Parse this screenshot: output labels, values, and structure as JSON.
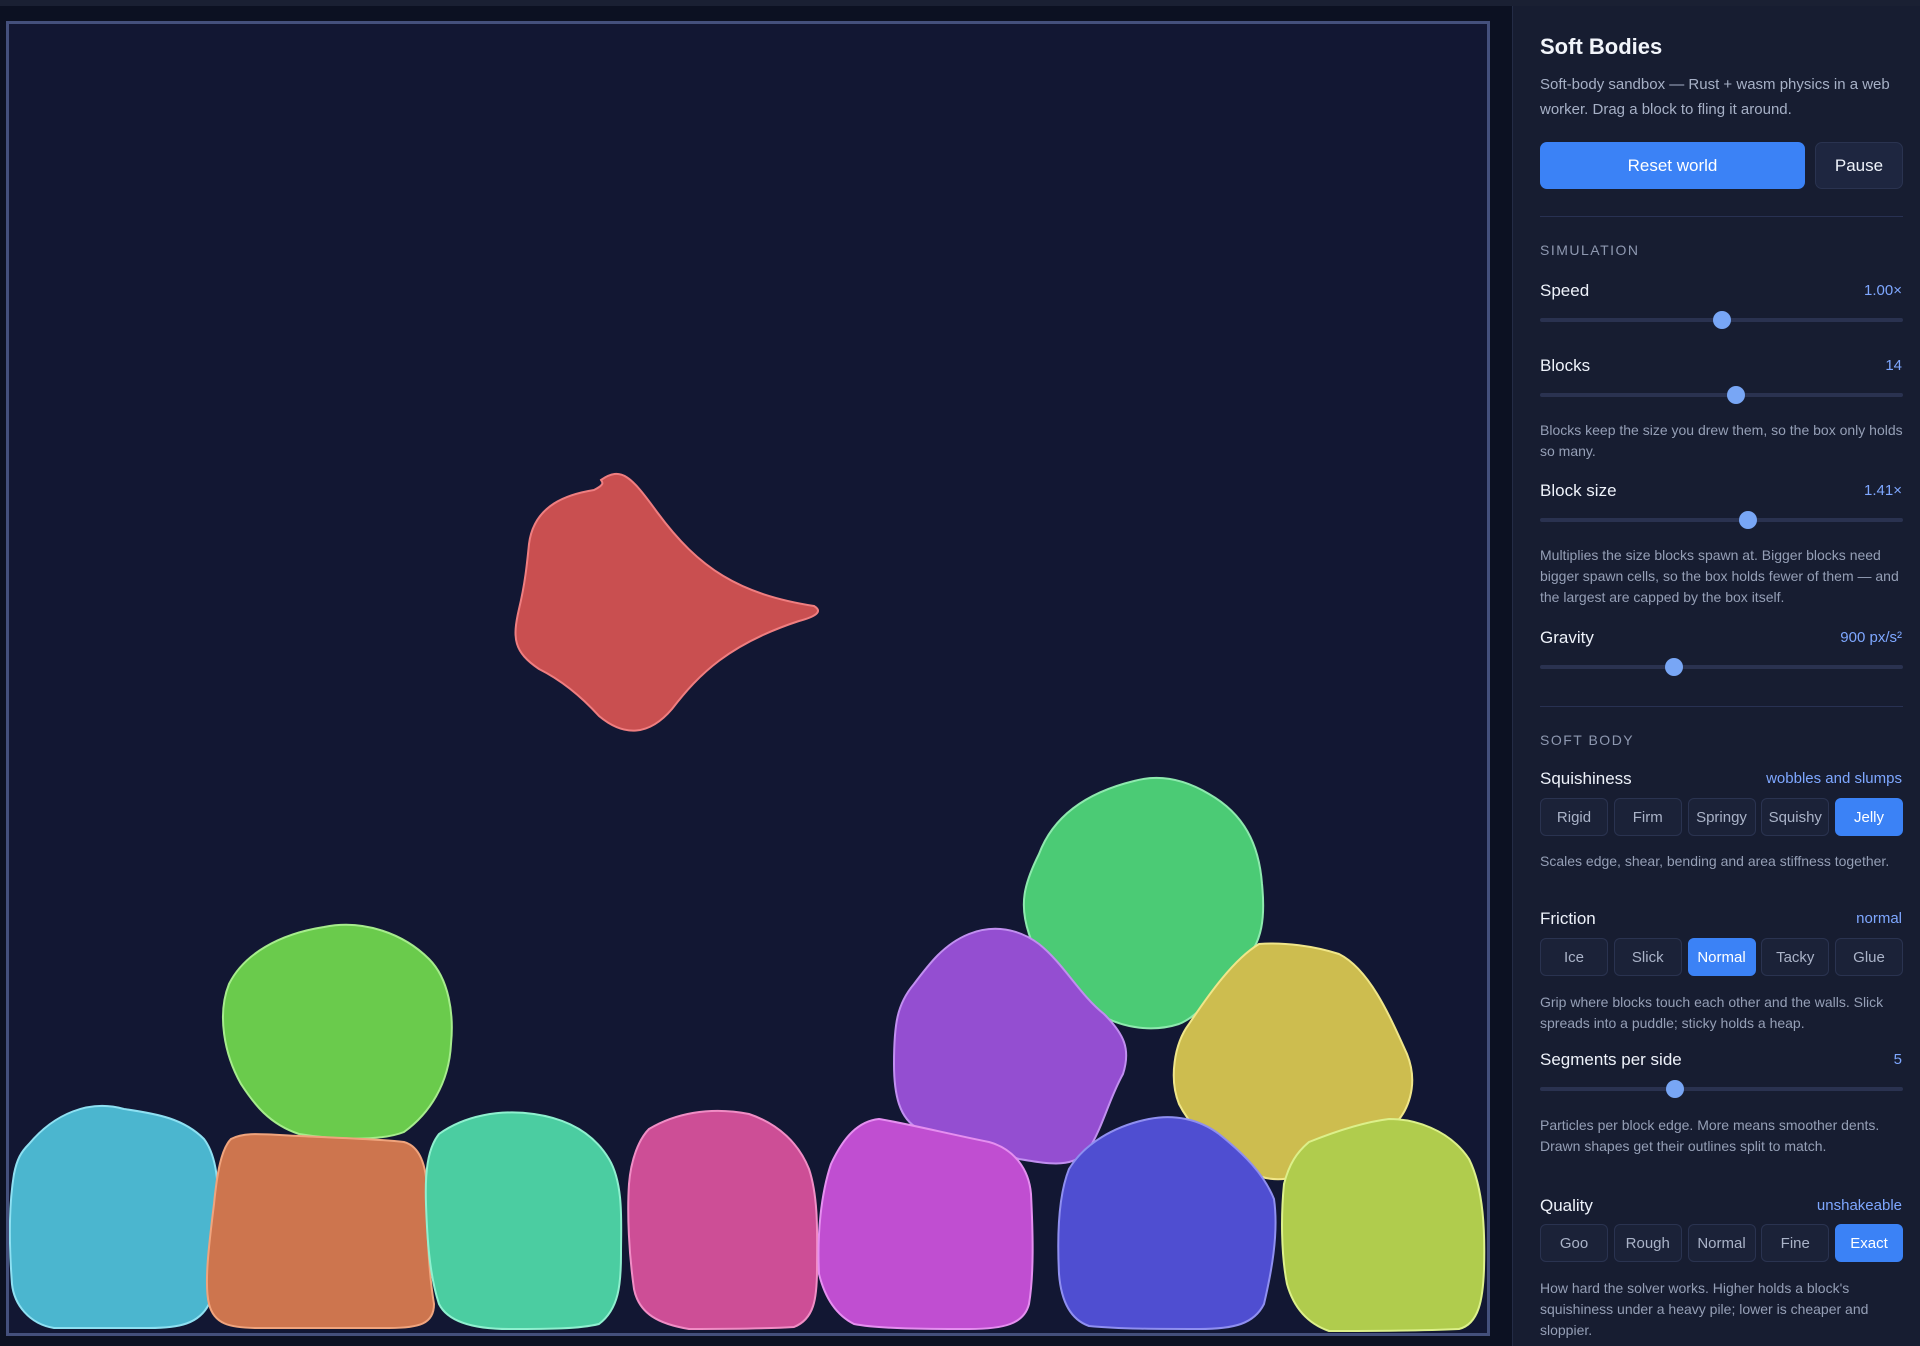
{
  "panel": {
    "title": "Soft Bodies",
    "description": "Soft-body sandbox — Rust + wasm physics in a web worker. Drag a block to fling it around.",
    "reset_label": "Reset world",
    "pause_label": "Pause"
  },
  "simulation": {
    "heading": "SIMULATION",
    "speed": {
      "label": "Speed",
      "value": "1.00×",
      "level": 0.5
    },
    "blocks": {
      "label": "Blocks",
      "value": "14",
      "level": 0.54,
      "help": "Blocks keep the size you drew them, so the box only holds so many."
    },
    "block_size": {
      "label": "Block size",
      "value": "1.41×",
      "level": 0.57,
      "help": "Multiplies the size blocks spawn at. Bigger blocks need bigger spawn cells, so the box holds fewer of them — and the largest are capped by the box itself."
    },
    "gravity": {
      "label": "Gravity",
      "value": "900 px/s²",
      "level": 0.37
    }
  },
  "soft_body": {
    "heading": "SOFT BODY",
    "squishiness": {
      "label": "Squishiness",
      "value": "wobbles and slumps",
      "options": [
        "Rigid",
        "Firm",
        "Springy",
        "Squishy",
        "Jelly"
      ],
      "selected": "Jelly",
      "help": "Scales edge, shear, bending and area stiffness together."
    },
    "friction": {
      "label": "Friction",
      "value": "normal",
      "options": [
        "Ice",
        "Slick",
        "Normal",
        "Tacky",
        "Glue"
      ],
      "selected": "Normal",
      "help": "Grip where blocks touch each other and the walls. Slick spreads into a puddle; sticky holds a heap."
    },
    "segments": {
      "label": "Segments per side",
      "value": "5",
      "level": 0.37,
      "help": "Particles per block edge. More means smoother dents. Drawn shapes get their outlines split to match."
    },
    "quality": {
      "label": "Quality",
      "value": "unshakeable",
      "options": [
        "Goo",
        "Rough",
        "Normal",
        "Fine",
        "Exact"
      ],
      "selected": "Exact",
      "help": "How hard the solver works. Higher holds a block's squishiness under a heavy pile; lower is cheaper and sloppier."
    }
  },
  "colors": {
    "accent": "#3b82f6",
    "canvas_bg": "#121733",
    "blocks": [
      "#c94f50",
      "#4bcb75",
      "#944ed1",
      "#cdbd4f",
      "#6acb4c",
      "#4bb6cf",
      "#cd754e",
      "#4bcda1",
      "#cd4e96",
      "#c04ed1",
      "#4f4ed1",
      "#b0cc4d"
    ]
  }
}
